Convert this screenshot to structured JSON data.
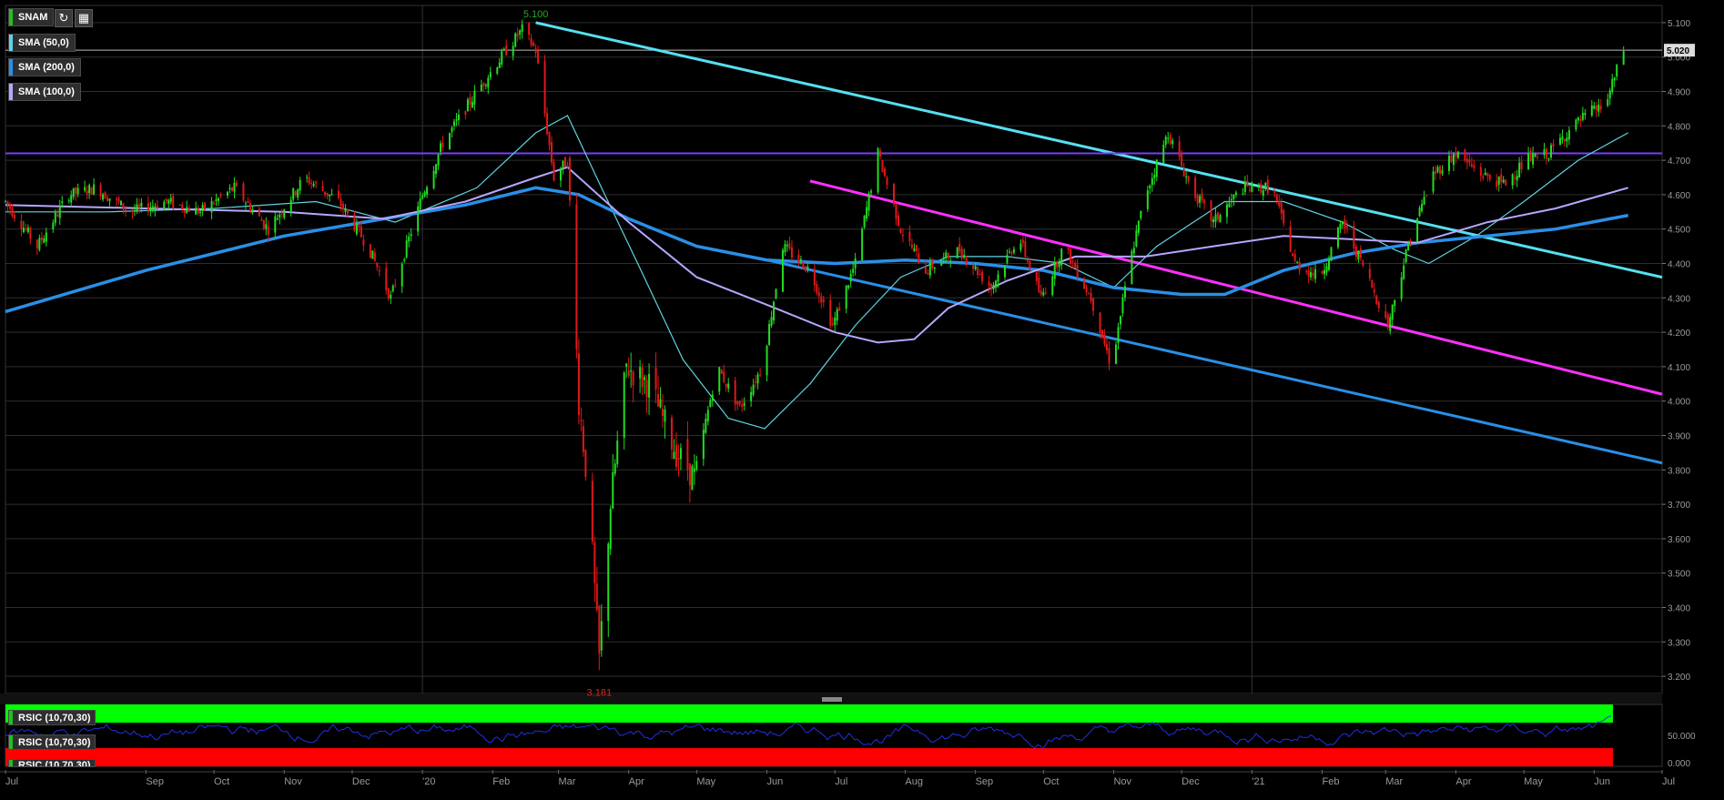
{
  "header": {
    "symbol": "SNAM",
    "refresh_icon": "refresh-icon",
    "calendar_icon": "calendar-icon"
  },
  "indicators": [
    {
      "label": "SMA (50,0)",
      "color": "#5fd3e0"
    },
    {
      "label": "SMA (200,0)",
      "color": "#2a8fe6"
    },
    {
      "label": "SMA (100,0)",
      "color": "#b8a6ff"
    }
  ],
  "rsi_panel": {
    "labels": [
      "RSIC (10,70,30)",
      "RSIC (10,70,30)",
      "RSIC (10,70,30)"
    ],
    "tick_labels": [
      "50.000",
      "0.000"
    ],
    "overbought_color": "#00ff00",
    "oversold_color": "#ff0000",
    "line_color": "#2030e0"
  },
  "chart_data": {
    "type": "candlestick",
    "xlim": [
      "2019-07-01",
      "2021-07-01"
    ],
    "ylim": [
      3.15,
      5.15
    ],
    "grid": true,
    "last_price": 5.02,
    "annotations": [
      {
        "text": "5.100",
        "date": "2020-02-20",
        "value": 5.1
      },
      {
        "text": "3.181",
        "date": "2020-03-19",
        "value": 3.181
      }
    ],
    "y_ticks": [
      3.2,
      3.3,
      3.4,
      3.5,
      3.6,
      3.7,
      3.8,
      3.9,
      4.0,
      4.1,
      4.2,
      4.3,
      4.4,
      4.5,
      4.6,
      4.7,
      4.8,
      4.9,
      5.0,
      5.1
    ],
    "y_tick_labels": [
      "3.200",
      "3.300",
      "3.400",
      "3.500",
      "3.600",
      "3.700",
      "3.800",
      "3.900",
      "4.000",
      "4.100",
      "4.200",
      "4.300",
      "4.400",
      "4.500",
      "4.600",
      "4.700",
      "4.800",
      "4.900",
      "5.000",
      "5.100"
    ],
    "x_ticks": [
      {
        "label": "Jul",
        "date": "2019-07-01"
      },
      {
        "label": "Sep",
        "date": "2019-09-01"
      },
      {
        "label": "Oct",
        "date": "2019-10-01"
      },
      {
        "label": "Nov",
        "date": "2019-11-01"
      },
      {
        "label": "Dec",
        "date": "2019-12-01"
      },
      {
        "label": "'20",
        "date": "2020-01-01"
      },
      {
        "label": "Feb",
        "date": "2020-02-01"
      },
      {
        "label": "Mar",
        "date": "2020-03-01"
      },
      {
        "label": "Apr",
        "date": "2020-04-01"
      },
      {
        "label": "May",
        "date": "2020-05-01"
      },
      {
        "label": "Jun",
        "date": "2020-06-01"
      },
      {
        "label": "Jul",
        "date": "2020-07-01"
      },
      {
        "label": "Aug",
        "date": "2020-08-01"
      },
      {
        "label": "Sep",
        "date": "2020-09-01"
      },
      {
        "label": "Oct",
        "date": "2020-10-01"
      },
      {
        "label": "Nov",
        "date": "2020-11-01"
      },
      {
        "label": "Dec",
        "date": "2020-12-01"
      },
      {
        "label": "'21",
        "date": "2021-01-01"
      },
      {
        "label": "Feb",
        "date": "2021-02-01"
      },
      {
        "label": "Mar",
        "date": "2021-03-01"
      },
      {
        "label": "Apr",
        "date": "2021-04-01"
      },
      {
        "label": "May",
        "date": "2021-05-01"
      },
      {
        "label": "Jun",
        "date": "2021-06-01"
      },
      {
        "label": "Jul",
        "date": "2021-07-01"
      }
    ],
    "price_path": [
      [
        "2019-07-01",
        4.58
      ],
      [
        "2019-07-15",
        4.45
      ],
      [
        "2019-07-29",
        4.6
      ],
      [
        "2019-08-10",
        4.62
      ],
      [
        "2019-08-25",
        4.55
      ],
      [
        "2019-09-10",
        4.58
      ],
      [
        "2019-09-25",
        4.55
      ],
      [
        "2019-10-10",
        4.62
      ],
      [
        "2019-10-25",
        4.5
      ],
      [
        "2019-11-10",
        4.65
      ],
      [
        "2019-11-25",
        4.58
      ],
      [
        "2019-12-08",
        4.45
      ],
      [
        "2019-12-18",
        4.3
      ],
      [
        "2020-01-01",
        4.6
      ],
      [
        "2020-01-10",
        4.75
      ],
      [
        "2020-01-25",
        4.9
      ],
      [
        "2020-02-07",
        5.02
      ],
      [
        "2020-02-14",
        5.08
      ],
      [
        "2020-02-20",
        5.02
      ],
      [
        "2020-02-28",
        4.65
      ],
      [
        "2020-03-05",
        4.7
      ],
      [
        "2020-03-10",
        4.0
      ],
      [
        "2020-03-14",
        3.75
      ],
      [
        "2020-03-19",
        3.25
      ],
      [
        "2020-03-24",
        3.7
      ],
      [
        "2020-03-31",
        4.1
      ],
      [
        "2020-04-10",
        4.05
      ],
      [
        "2020-04-22",
        3.85
      ],
      [
        "2020-04-30",
        3.78
      ],
      [
        "2020-05-10",
        4.1
      ],
      [
        "2020-05-20",
        3.98
      ],
      [
        "2020-05-30",
        4.1
      ],
      [
        "2020-06-08",
        4.45
      ],
      [
        "2020-06-20",
        4.38
      ],
      [
        "2020-06-30",
        4.22
      ],
      [
        "2020-07-10",
        4.4
      ],
      [
        "2020-07-20",
        4.72
      ],
      [
        "2020-07-30",
        4.5
      ],
      [
        "2020-08-10",
        4.38
      ],
      [
        "2020-08-25",
        4.44
      ],
      [
        "2020-09-08",
        4.33
      ],
      [
        "2020-09-20",
        4.48
      ],
      [
        "2020-09-30",
        4.3
      ],
      [
        "2020-10-10",
        4.45
      ],
      [
        "2020-10-22",
        4.3
      ],
      [
        "2020-10-31",
        4.1
      ],
      [
        "2020-11-08",
        4.4
      ],
      [
        "2020-11-15",
        4.6
      ],
      [
        "2020-11-25",
        4.78
      ],
      [
        "2020-12-05",
        4.62
      ],
      [
        "2020-12-15",
        4.52
      ],
      [
        "2020-12-28",
        4.62
      ],
      [
        "2021-01-10",
        4.62
      ],
      [
        "2021-01-20",
        4.4
      ],
      [
        "2021-01-31",
        4.36
      ],
      [
        "2021-02-10",
        4.52
      ],
      [
        "2021-02-20",
        4.38
      ],
      [
        "2021-03-02",
        4.22
      ],
      [
        "2021-03-12",
        4.48
      ],
      [
        "2021-03-22",
        4.66
      ],
      [
        "2021-04-01",
        4.72
      ],
      [
        "2021-04-12",
        4.66
      ],
      [
        "2021-04-22",
        4.63
      ],
      [
        "2021-05-02",
        4.7
      ],
      [
        "2021-05-12",
        4.72
      ],
      [
        "2021-05-20",
        4.78
      ],
      [
        "2021-05-30",
        4.84
      ],
      [
        "2021-06-06",
        4.86
      ],
      [
        "2021-06-14",
        5.02
      ]
    ],
    "series": [
      {
        "name": "SMA (50,0)",
        "color": "#5fd3e0",
        "points": [
          [
            "2019-07-01",
            4.55
          ],
          [
            "2019-08-15",
            4.55
          ],
          [
            "2019-10-01",
            4.56
          ],
          [
            "2019-11-15",
            4.58
          ],
          [
            "2019-12-20",
            4.52
          ],
          [
            "2020-01-25",
            4.62
          ],
          [
            "2020-02-20",
            4.78
          ],
          [
            "2020-03-05",
            4.83
          ],
          [
            "2020-03-20",
            4.62
          ],
          [
            "2020-04-05",
            4.4
          ],
          [
            "2020-04-25",
            4.12
          ],
          [
            "2020-05-15",
            3.95
          ],
          [
            "2020-05-31",
            3.92
          ],
          [
            "2020-06-20",
            4.05
          ],
          [
            "2020-07-10",
            4.22
          ],
          [
            "2020-07-30",
            4.36
          ],
          [
            "2020-08-20",
            4.42
          ],
          [
            "2020-09-15",
            4.42
          ],
          [
            "2020-10-10",
            4.4
          ],
          [
            "2020-11-01",
            4.33
          ],
          [
            "2020-11-20",
            4.45
          ],
          [
            "2020-12-20",
            4.58
          ],
          [
            "2021-01-15",
            4.58
          ],
          [
            "2021-02-10",
            4.52
          ],
          [
            "2021-03-05",
            4.44
          ],
          [
            "2021-03-20",
            4.4
          ],
          [
            "2021-04-10",
            4.48
          ],
          [
            "2021-05-01",
            4.58
          ],
          [
            "2021-05-25",
            4.7
          ],
          [
            "2021-06-16",
            4.78
          ]
        ]
      },
      {
        "name": "SMA (200,0)",
        "color": "#2a8fe6",
        "points": [
          [
            "2019-07-01",
            4.26
          ],
          [
            "2019-09-01",
            4.38
          ],
          [
            "2019-11-01",
            4.48
          ],
          [
            "2019-12-15",
            4.53
          ],
          [
            "2020-01-20",
            4.57
          ],
          [
            "2020-02-20",
            4.62
          ],
          [
            "2020-03-10",
            4.6
          ],
          [
            "2020-04-01",
            4.53
          ],
          [
            "2020-05-01",
            4.45
          ],
          [
            "2020-06-01",
            4.41
          ],
          [
            "2020-07-01",
            4.4
          ],
          [
            "2020-08-01",
            4.41
          ],
          [
            "2020-09-01",
            4.4
          ],
          [
            "2020-10-01",
            4.38
          ],
          [
            "2020-11-01",
            4.33
          ],
          [
            "2020-12-01",
            4.31
          ],
          [
            "2020-12-20",
            4.31
          ],
          [
            "2021-01-15",
            4.38
          ],
          [
            "2021-02-15",
            4.43
          ],
          [
            "2021-03-15",
            4.46
          ],
          [
            "2021-04-15",
            4.48
          ],
          [
            "2021-05-15",
            4.5
          ],
          [
            "2021-06-16",
            4.54
          ]
        ]
      },
      {
        "name": "SMA (100,0)",
        "color": "#b8a6ff",
        "points": [
          [
            "2019-07-01",
            4.57
          ],
          [
            "2019-09-01",
            4.56
          ],
          [
            "2019-11-01",
            4.55
          ],
          [
            "2019-12-15",
            4.53
          ],
          [
            "2020-01-20",
            4.58
          ],
          [
            "2020-02-20",
            4.65
          ],
          [
            "2020-03-05",
            4.68
          ],
          [
            "2020-04-01",
            4.52
          ],
          [
            "2020-05-01",
            4.36
          ],
          [
            "2020-06-01",
            4.28
          ],
          [
            "2020-07-01",
            4.2
          ],
          [
            "2020-07-20",
            4.17
          ],
          [
            "2020-08-05",
            4.18
          ],
          [
            "2020-08-20",
            4.27
          ],
          [
            "2020-09-15",
            4.35
          ],
          [
            "2020-10-15",
            4.42
          ],
          [
            "2020-11-15",
            4.42
          ],
          [
            "2020-12-15",
            4.45
          ],
          [
            "2021-01-15",
            4.48
          ],
          [
            "2021-02-15",
            4.47
          ],
          [
            "2021-03-15",
            4.46
          ],
          [
            "2021-04-15",
            4.52
          ],
          [
            "2021-05-15",
            4.56
          ],
          [
            "2021-06-16",
            4.62
          ]
        ]
      }
    ],
    "trend_lines": [
      {
        "name": "cyan-trendline",
        "color": "#55e0f0",
        "from": [
          "2020-02-20",
          5.1
        ],
        "to": [
          "2021-07-01",
          4.36
        ]
      },
      {
        "name": "magenta-trendline",
        "color": "#ff30ff",
        "from": [
          "2020-06-20",
          4.64
        ],
        "to": [
          "2021-07-01",
          4.02
        ]
      },
      {
        "name": "blue-channel-line",
        "color": "#2a8fe6",
        "from": [
          "2020-06-01",
          4.41
        ],
        "to": [
          "2021-07-01",
          3.82
        ]
      },
      {
        "name": "resistance-line",
        "color": "#7a3cff",
        "from": [
          "2019-07-01",
          4.72
        ],
        "to": [
          "2021-07-01",
          4.72
        ]
      }
    ]
  }
}
